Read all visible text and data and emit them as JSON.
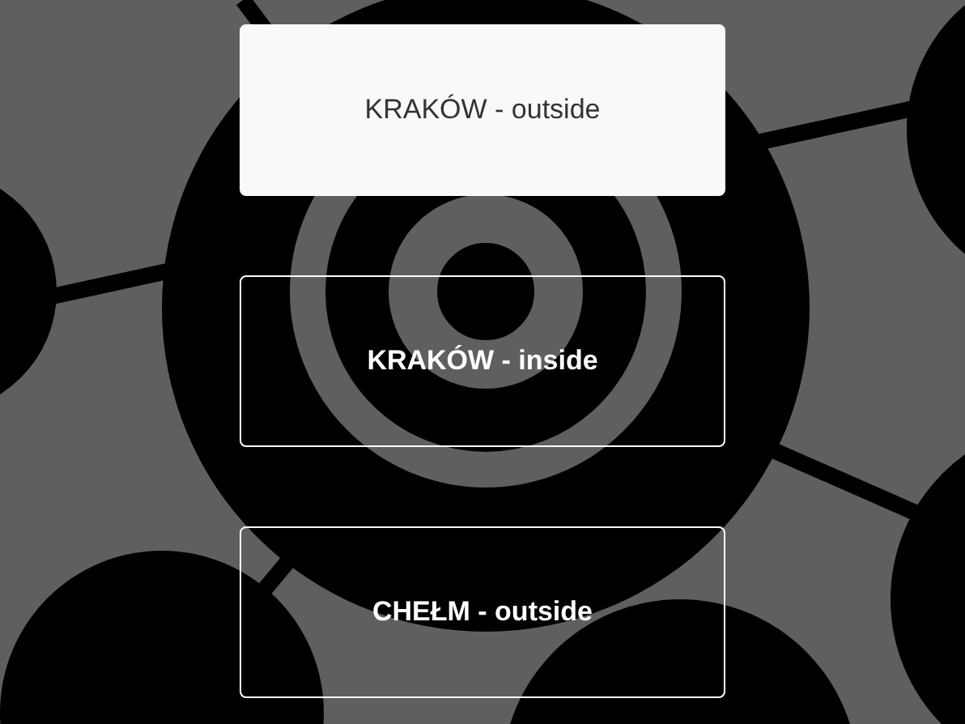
{
  "options": [
    {
      "label": "KRAKÓW - outside",
      "selected": true
    },
    {
      "label": "KRAKÓW - inside",
      "selected": false
    },
    {
      "label": "CHEŁM - outside",
      "selected": false
    }
  ]
}
